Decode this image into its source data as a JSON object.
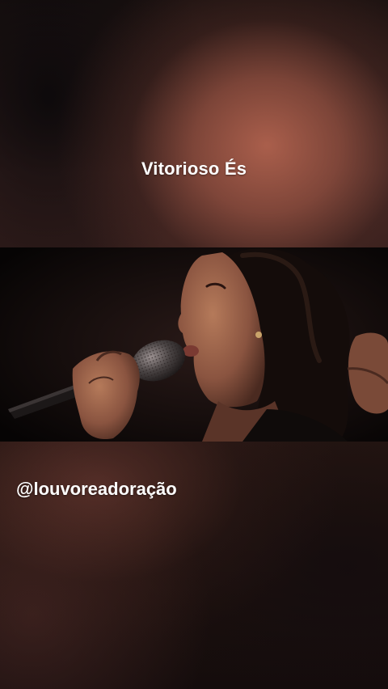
{
  "overlay": {
    "title": "Vitorioso És",
    "handle": "@louvoreadoração"
  },
  "video": {
    "description_icon": "singer-with-microphone-image"
  },
  "colors": {
    "text": "#ffffff",
    "backdrop_warm": "#b0624e",
    "backdrop_dark": "#120c0b"
  }
}
